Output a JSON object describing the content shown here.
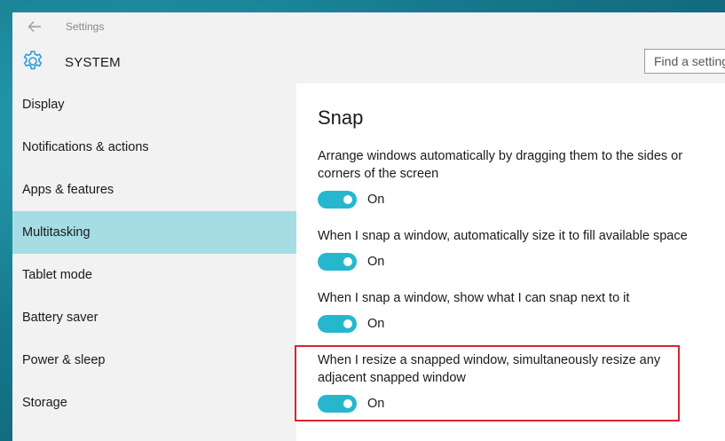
{
  "window": {
    "title": "Settings",
    "section_title": "SYSTEM"
  },
  "search": {
    "placeholder": "Find a setting"
  },
  "sidebar": {
    "items": [
      {
        "label": "Display"
      },
      {
        "label": "Notifications & actions"
      },
      {
        "label": "Apps & features"
      },
      {
        "label": "Multitasking",
        "selected": true
      },
      {
        "label": "Tablet mode"
      },
      {
        "label": "Battery saver"
      },
      {
        "label": "Power & sleep"
      },
      {
        "label": "Storage"
      }
    ]
  },
  "main": {
    "heading": "Snap",
    "settings": [
      {
        "line1": "Arrange windows automatically by dragging them to the sides or",
        "line2": "corners of the screen",
        "state": "On"
      },
      {
        "line1": "When I snap a window, automatically size it to fill available space",
        "state": "On"
      },
      {
        "line1": "When I snap a window, show what I can snap next to it",
        "state": "On"
      },
      {
        "line1": "When I resize a snapped window, simultaneously resize any",
        "line2": "adjacent snapped window",
        "state": "On"
      }
    ]
  },
  "colors": {
    "accent": "#26b7cf",
    "selected_nav": "#a6dde5",
    "highlight": "#d9262c"
  }
}
